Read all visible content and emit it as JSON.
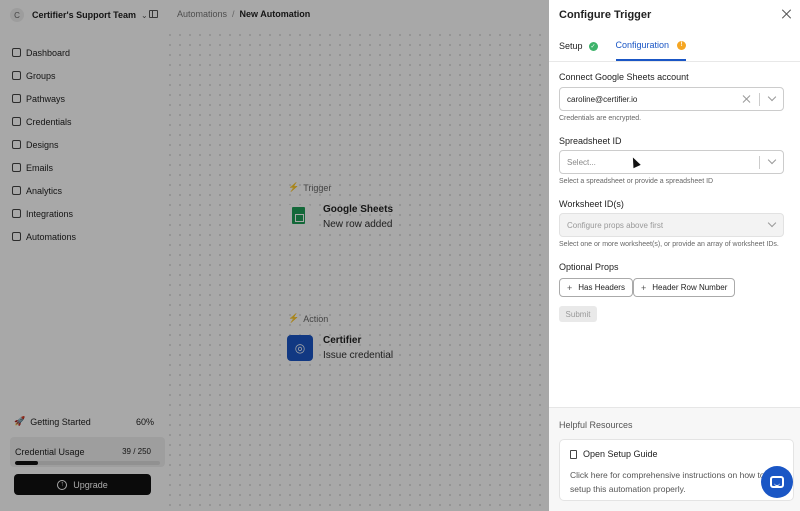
{
  "team": {
    "initial": "C",
    "name": "Certifier's Support Team"
  },
  "breadcrumb": {
    "section": "Automations",
    "separator": "/",
    "current": "New Automation"
  },
  "sidebar": {
    "items": [
      {
        "label": "Dashboard",
        "icon": "dashboard-icon"
      },
      {
        "label": "Groups",
        "icon": "groups-icon"
      },
      {
        "label": "Pathways",
        "icon": "pathways-icon"
      },
      {
        "label": "Credentials",
        "icon": "credentials-icon"
      },
      {
        "label": "Designs",
        "icon": "designs-icon"
      },
      {
        "label": "Emails",
        "icon": "emails-icon"
      },
      {
        "label": "Analytics",
        "icon": "analytics-icon"
      },
      {
        "label": "Integrations",
        "icon": "integrations-icon"
      },
      {
        "label": "Automations",
        "icon": "automations-icon"
      }
    ],
    "getting_started": {
      "label": "Getting Started",
      "percent": "60%"
    },
    "usage": {
      "label": "Credential Usage",
      "value": "39 / 250",
      "fraction": 0.156
    },
    "upgrade_label": "Upgrade"
  },
  "canvas": {
    "trigger": {
      "tag": "Trigger",
      "name": "Google Sheets",
      "sub": "New row added",
      "icon": "google-sheets-icon"
    },
    "action": {
      "tag": "Action",
      "name": "Certifier",
      "sub": "Issue credential",
      "icon": "certifier-icon"
    }
  },
  "panel": {
    "title": "Configure Trigger",
    "tabs": [
      {
        "label": "Setup",
        "status": "complete"
      },
      {
        "label": "Configuration",
        "status": "warning"
      }
    ],
    "account": {
      "label": "Connect Google Sheets account",
      "value": "caroline@certifier.io",
      "help": "Credentials are encrypted."
    },
    "spreadsheet": {
      "label": "Spreadsheet ID",
      "placeholder": "Select...",
      "help": "Select a spreadsheet or provide a spreadsheet ID"
    },
    "worksheet": {
      "label": "Worksheet ID(s)",
      "placeholder": "Configure props above first",
      "help": "Select one or more worksheet(s), or provide an array of worksheet IDs."
    },
    "optional": {
      "label": "Optional Props",
      "props": [
        "Has Headers",
        "Header Row Number"
      ]
    },
    "submit_label": "Submit",
    "resources": {
      "title": "Helpful Resources",
      "card_title": "Open Setup Guide",
      "card_desc": "Click here for comprehensive instructions on how to setup this automation properly."
    }
  },
  "colors": {
    "accent": "#1a56c5",
    "success": "#3db36a",
    "warning": "#f5a623"
  }
}
